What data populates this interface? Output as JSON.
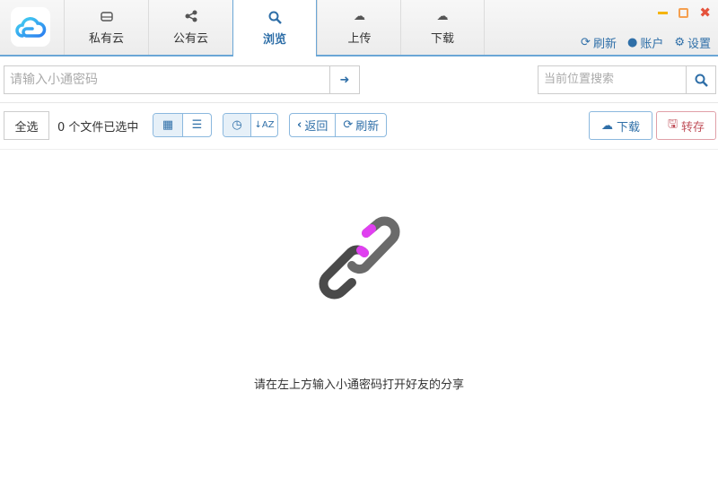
{
  "tabs": [
    {
      "label": "私有云",
      "icon": "hdd-icon"
    },
    {
      "label": "公有云",
      "icon": "share-icon"
    },
    {
      "label": "浏览",
      "icon": "search-icon",
      "active": true
    },
    {
      "label": "上传",
      "icon": "cloud-upload-icon"
    },
    {
      "label": "下载",
      "icon": "cloud-download-icon"
    }
  ],
  "top_actions": {
    "refresh": "刷新",
    "account": "账户",
    "settings": "设置"
  },
  "code_input": {
    "placeholder": "请输入小通密码",
    "value": ""
  },
  "location_search": {
    "placeholder": "当前位置搜索",
    "value": ""
  },
  "toolbar": {
    "select_all": "全选",
    "selected_count": "0 个文件已选中",
    "back": "返回",
    "refresh": "刷新",
    "download": "下载",
    "save": "转存"
  },
  "empty_message": "请在左上方输入小通密码打开好友的分享",
  "colors": {
    "accent": "#2f6fa8",
    "save": "#c0505a",
    "close": "#e5533d",
    "minimize": "#f5b400"
  }
}
